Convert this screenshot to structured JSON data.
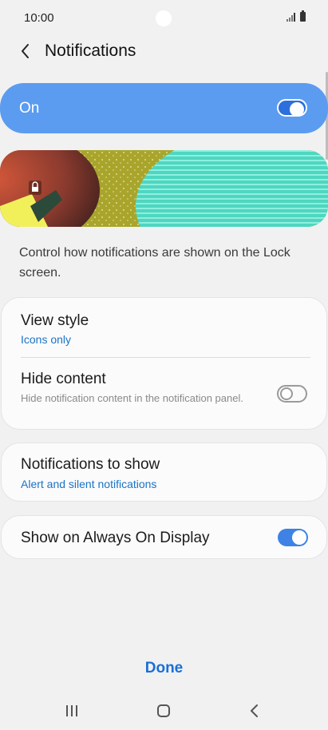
{
  "status_bar": {
    "time": "10:00"
  },
  "header": {
    "title": "Notifications"
  },
  "master": {
    "label": "On",
    "enabled": true
  },
  "description": "Control how notifications are shown on the Lock screen.",
  "view_style": {
    "title": "View style",
    "value": "Icons only"
  },
  "hide_content": {
    "title": "Hide content",
    "description": "Hide notification content in the notification panel.",
    "enabled": false
  },
  "notifications_to_show": {
    "title": "Notifications to show",
    "value": "Alert and silent notifications"
  },
  "always_on_display": {
    "title": "Show on Always On Display",
    "enabled": true
  },
  "footer": {
    "done_label": "Done"
  },
  "colors": {
    "accent": "#3e82e6",
    "master_bg": "#5b9cf0",
    "link": "#1a73c8"
  }
}
